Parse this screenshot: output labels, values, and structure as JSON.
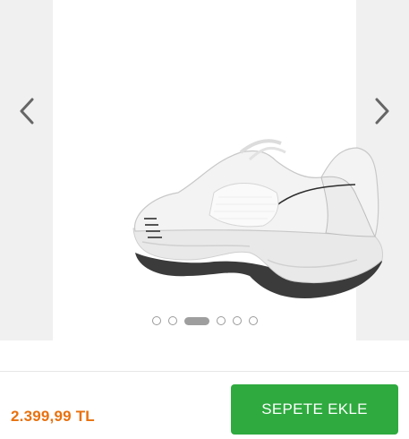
{
  "gallery": {
    "prev_icon": "chevron-left-icon",
    "next_icon": "chevron-right-icon",
    "image_alt": "",
    "dot_count": 6,
    "active_dot_index": 2
  },
  "purchase": {
    "price": "2.399,99 TL",
    "cart_button_label": "SEPETE EKLE"
  },
  "colors": {
    "price": "#e8710e",
    "cart_button": "#2eaa3f",
    "gallery_background": "#f0f0f0"
  }
}
